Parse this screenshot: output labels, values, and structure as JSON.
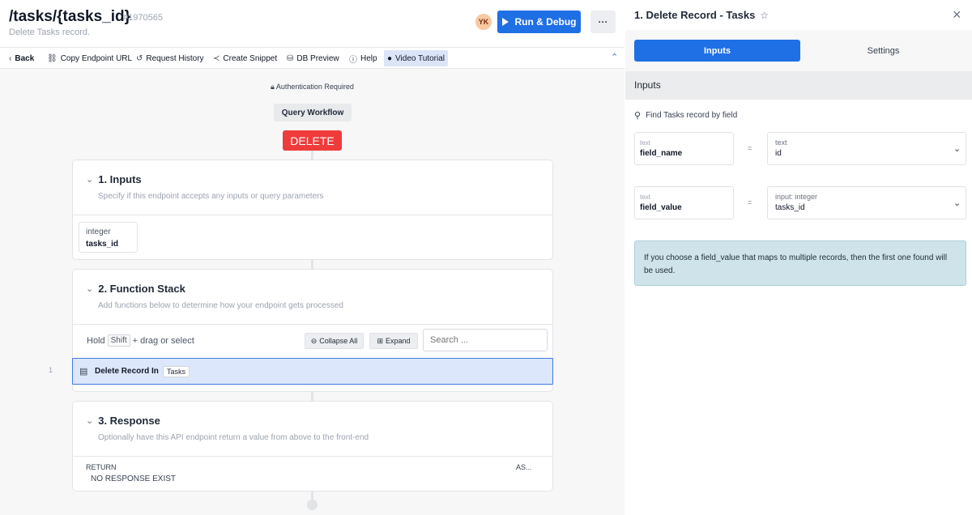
{
  "header": {
    "route": "/tasks/{tasks_id}",
    "route_id": "#1970565",
    "description": "Delete Tasks record.",
    "avatar_initials": "YK",
    "run_label": "Run & Debug",
    "more_label": "···"
  },
  "toolbar": {
    "back": "Back",
    "copy_url": "Copy Endpoint URL",
    "history": "Request History",
    "snippet": "Create Snippet",
    "db_preview": "DB Preview",
    "help": "Help",
    "video": "Video Tutorial"
  },
  "canvas": {
    "auth": "Authentication Required",
    "workflow": "Query Workflow",
    "method": "DELETE",
    "inputs": {
      "title": "1. Inputs",
      "subtitle": "Specify if this endpoint accepts any inputs or query parameters",
      "param_type": "integer",
      "param_name": "tasks_id"
    },
    "function_stack": {
      "title": "2. Function Stack",
      "subtitle": "Add functions below to determine how your endpoint gets processed",
      "hold_prefix": "Hold",
      "hold_key": "Shift",
      "hold_suffix": "+ drag or select",
      "collapse_all": "Collapse All",
      "expand": "Expand",
      "search_placeholder": "Search ...",
      "line_number": "1",
      "function_label": "Delete Record In",
      "function_tag": "Tasks"
    },
    "response": {
      "title": "3. Response",
      "subtitle": "Optionally have this API endpoint return a value from above to the front-end",
      "return_header": "RETURN",
      "as_header": "AS...",
      "empty": "NO RESPONSE EXIST"
    }
  },
  "panel": {
    "title": "1.  Delete Record - Tasks",
    "tabs": {
      "inputs": "Inputs",
      "settings": "Settings"
    },
    "section": "Inputs",
    "find_label": "Find Tasks record by field",
    "row1": {
      "left_sub": "text",
      "left_val": "field_name",
      "eq": "=",
      "right_sub": "text",
      "right_val": "id"
    },
    "row2": {
      "left_sub": "text",
      "left_val": "field_value",
      "eq": "=",
      "right_sub": "input: integer",
      "right_val": "tasks_id"
    },
    "info": "If you choose a field_value that maps to multiple records, then the first one found will be used."
  },
  "colors": {
    "accent": "#1f6fe5",
    "delete": "#ef3b3b",
    "selection_bg": "#dde7fb",
    "info_bg": "#cfe4ea"
  },
  "icons": {
    "back": "chevron-left-icon",
    "copy": "link-icon",
    "history": "history-icon",
    "snippet": "share-icon",
    "db": "database-icon",
    "help": "info-icon",
    "video": "play-circle-icon",
    "lock": "lock-icon",
    "table": "table-icon",
    "star": "star-icon",
    "close": "close-icon",
    "search": "search-icon"
  }
}
